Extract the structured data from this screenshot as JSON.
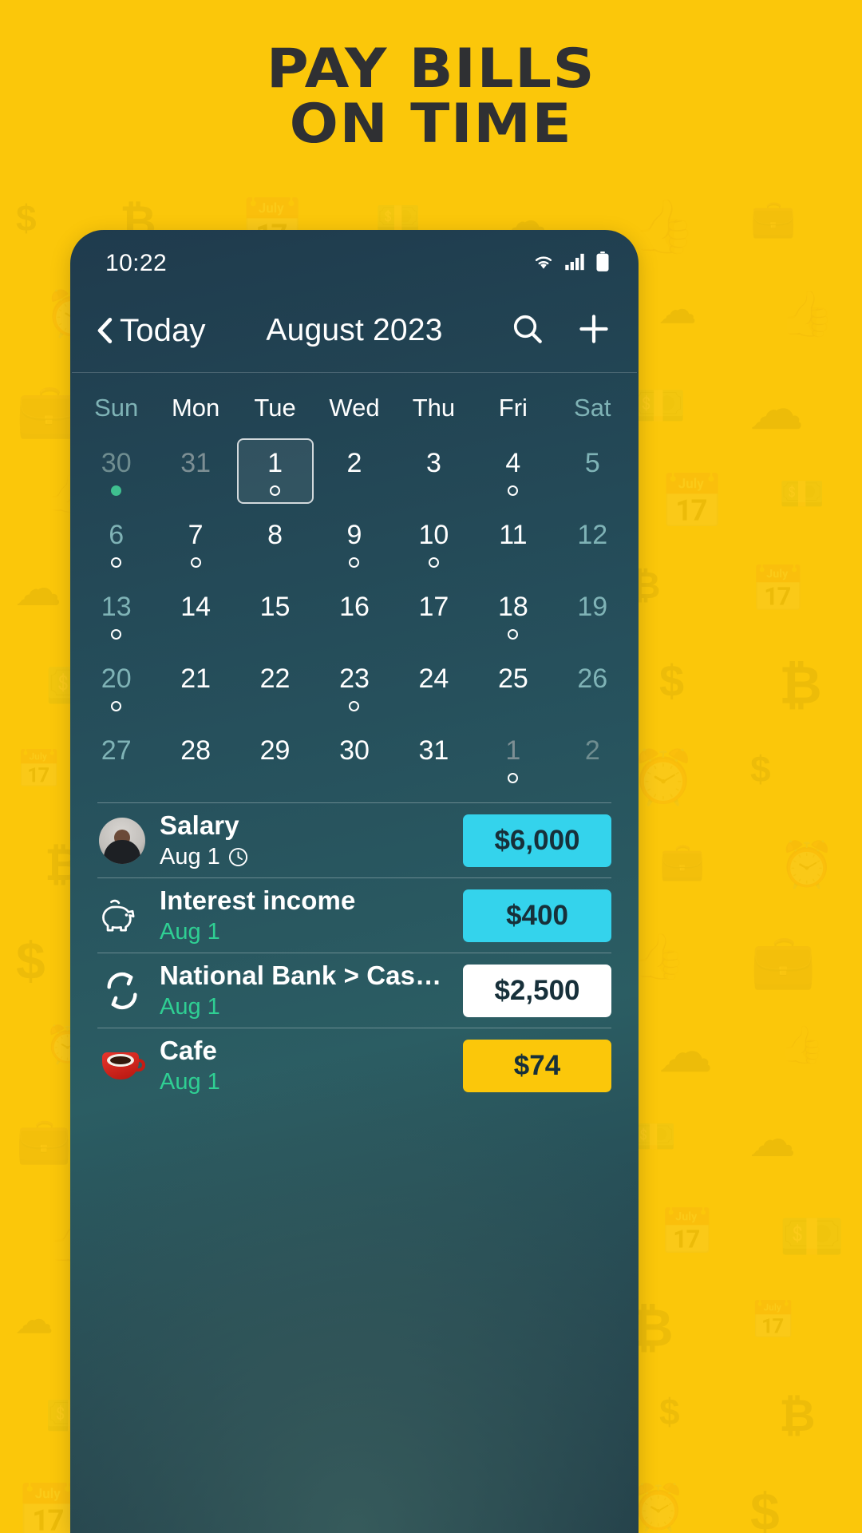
{
  "promo": {
    "headline_line1": "PAY BILLS",
    "headline_line2": "ON TIME",
    "background_color": "#FBC70A",
    "text_color": "#2f3033"
  },
  "status_bar": {
    "time": "10:22",
    "icons": [
      "wifi-icon",
      "cellular-signal-icon",
      "battery-icon"
    ]
  },
  "header": {
    "back_label": "Today",
    "back_icon": "chevron-left-icon",
    "title": "August 2023",
    "search_icon": "search-icon",
    "add_icon": "plus-icon"
  },
  "calendar": {
    "weekday_labels": [
      "Sun",
      "Mon",
      "Tue",
      "Wed",
      "Thu",
      "Fri",
      "Sat"
    ],
    "selected_day": "1",
    "accent_dot_color": "#3fbf8f",
    "weekend_color": "#7fb3b6",
    "weeks": [
      [
        {
          "d": "30",
          "other": true,
          "weekend": true,
          "marker": "filled",
          "selected": false
        },
        {
          "d": "31",
          "other": true,
          "weekend": false,
          "marker": "none",
          "selected": false
        },
        {
          "d": "1",
          "other": false,
          "weekend": false,
          "marker": "ring",
          "selected": true
        },
        {
          "d": "2",
          "other": false,
          "weekend": false,
          "marker": "none",
          "selected": false
        },
        {
          "d": "3",
          "other": false,
          "weekend": false,
          "marker": "none",
          "selected": false
        },
        {
          "d": "4",
          "other": false,
          "weekend": false,
          "marker": "ring",
          "selected": false
        },
        {
          "d": "5",
          "other": false,
          "weekend": true,
          "marker": "none",
          "selected": false
        }
      ],
      [
        {
          "d": "6",
          "other": false,
          "weekend": true,
          "marker": "ring",
          "selected": false
        },
        {
          "d": "7",
          "other": false,
          "weekend": false,
          "marker": "ring",
          "selected": false
        },
        {
          "d": "8",
          "other": false,
          "weekend": false,
          "marker": "none",
          "selected": false
        },
        {
          "d": "9",
          "other": false,
          "weekend": false,
          "marker": "ring",
          "selected": false
        },
        {
          "d": "10",
          "other": false,
          "weekend": false,
          "marker": "ring",
          "selected": false
        },
        {
          "d": "11",
          "other": false,
          "weekend": false,
          "marker": "none",
          "selected": false
        },
        {
          "d": "12",
          "other": false,
          "weekend": true,
          "marker": "none",
          "selected": false
        }
      ],
      [
        {
          "d": "13",
          "other": false,
          "weekend": true,
          "marker": "ring",
          "selected": false
        },
        {
          "d": "14",
          "other": false,
          "weekend": false,
          "marker": "none",
          "selected": false
        },
        {
          "d": "15",
          "other": false,
          "weekend": false,
          "marker": "none",
          "selected": false
        },
        {
          "d": "16",
          "other": false,
          "weekend": false,
          "marker": "none",
          "selected": false
        },
        {
          "d": "17",
          "other": false,
          "weekend": false,
          "marker": "none",
          "selected": false
        },
        {
          "d": "18",
          "other": false,
          "weekend": false,
          "marker": "ring",
          "selected": false
        },
        {
          "d": "19",
          "other": false,
          "weekend": true,
          "marker": "none",
          "selected": false
        }
      ],
      [
        {
          "d": "20",
          "other": false,
          "weekend": true,
          "marker": "ring",
          "selected": false
        },
        {
          "d": "21",
          "other": false,
          "weekend": false,
          "marker": "none",
          "selected": false
        },
        {
          "d": "22",
          "other": false,
          "weekend": false,
          "marker": "none",
          "selected": false
        },
        {
          "d": "23",
          "other": false,
          "weekend": false,
          "marker": "ring",
          "selected": false
        },
        {
          "d": "24",
          "other": false,
          "weekend": false,
          "marker": "none",
          "selected": false
        },
        {
          "d": "25",
          "other": false,
          "weekend": false,
          "marker": "none",
          "selected": false
        },
        {
          "d": "26",
          "other": false,
          "weekend": true,
          "marker": "none",
          "selected": false
        }
      ],
      [
        {
          "d": "27",
          "other": false,
          "weekend": true,
          "marker": "none",
          "selected": false
        },
        {
          "d": "28",
          "other": false,
          "weekend": false,
          "marker": "none",
          "selected": false
        },
        {
          "d": "29",
          "other": false,
          "weekend": false,
          "marker": "none",
          "selected": false
        },
        {
          "d": "30",
          "other": false,
          "weekend": false,
          "marker": "none",
          "selected": false
        },
        {
          "d": "31",
          "other": false,
          "weekend": false,
          "marker": "none",
          "selected": false
        },
        {
          "d": "1",
          "other": true,
          "weekend": false,
          "marker": "ring",
          "selected": false
        },
        {
          "d": "2",
          "other": true,
          "weekend": true,
          "marker": "none",
          "selected": false
        }
      ]
    ]
  },
  "transactions": [
    {
      "icon": "person-avatar-icon",
      "title": "Salary",
      "date": "Aug 1",
      "date_style": "white",
      "has_clock": true,
      "amount": "$6,000",
      "amount_style": "cyan"
    },
    {
      "icon": "piggy-bank-icon",
      "title": "Interest income",
      "date": "Aug 1",
      "date_style": "green",
      "has_clock": false,
      "amount": "$400",
      "amount_style": "cyan"
    },
    {
      "icon": "transfer-arrows-icon",
      "title": "National Bank > Cash Euro",
      "date": "Aug 1",
      "date_style": "green",
      "has_clock": false,
      "amount": "$2,500",
      "amount_style": "white"
    },
    {
      "icon": "coffee-cup-icon",
      "title": "Cafe",
      "date": "Aug 1",
      "date_style": "green",
      "has_clock": false,
      "amount": "$74",
      "amount_style": "yellow"
    }
  ],
  "colors": {
    "brand_yellow": "#FBC70A",
    "income_chip": "#34d3ec",
    "transfer_chip": "#ffffff",
    "expense_chip": "#FBC70A",
    "screen_dark": "#24454f",
    "date_green": "#2fcf93"
  }
}
